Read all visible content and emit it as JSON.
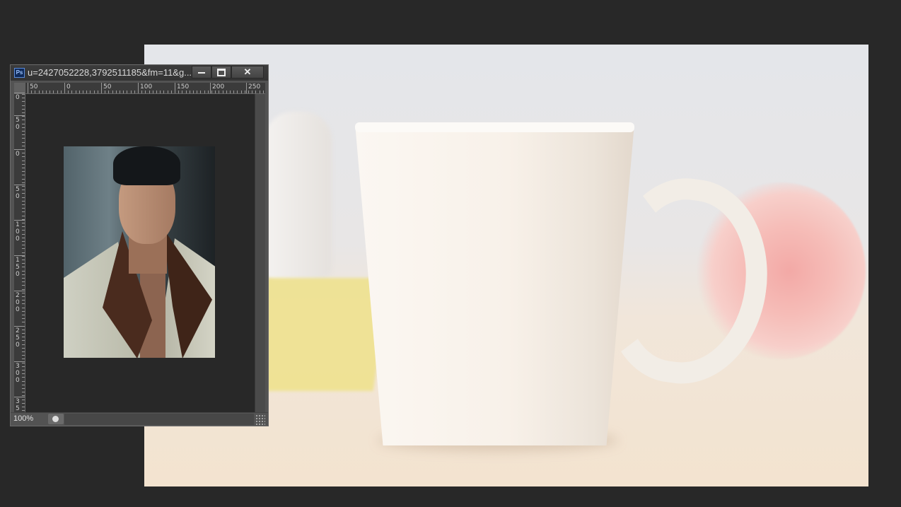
{
  "document": {
    "app_icon_text": "Ps",
    "title": "u=2427052228,3792511185&fm=11&g...",
    "zoom": "100%",
    "buttons": {
      "minimize": "minimize",
      "maximize": "maximize",
      "close": "✕"
    }
  },
  "rulers": {
    "horizontal_labels": [
      "50",
      "0",
      "50",
      "100",
      "150",
      "200",
      "250"
    ],
    "vertical_labels": [
      "0",
      "50",
      "0",
      "50",
      "100",
      "150",
      "200",
      "250",
      "300",
      "35"
    ]
  },
  "background_image": {
    "subject": "white-mug-with-rose"
  },
  "colors": {
    "workspace": "#282828",
    "panel": "#535353",
    "titlebar": "#3a3a3a"
  }
}
